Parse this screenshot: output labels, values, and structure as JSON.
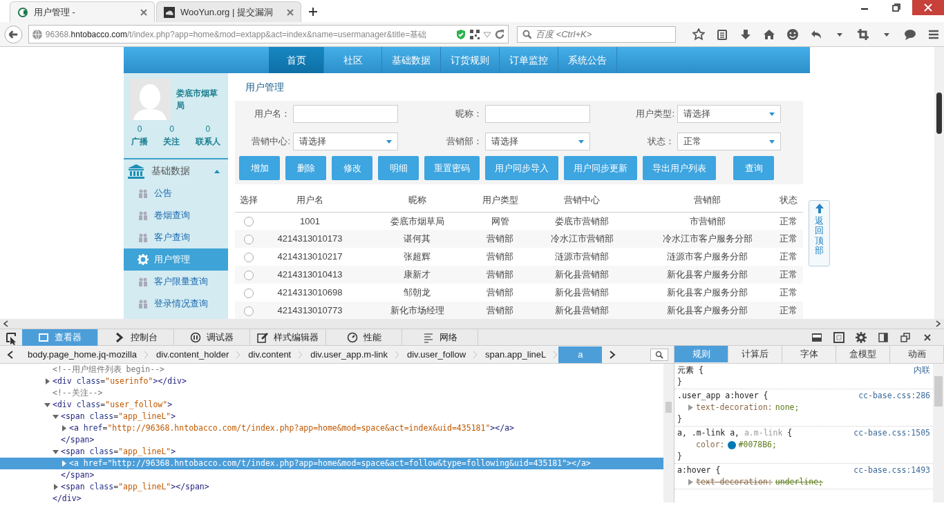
{
  "browser": {
    "tabs": [
      {
        "title": "用户管理 -",
        "selected": true
      },
      {
        "title": "WooYun.org | 提交漏洞",
        "selected": false
      }
    ],
    "url": {
      "subdomain": "96368.",
      "domain": "hntobacco.com",
      "path": "/t/index.php?app=home&mod=extapp&act=index&name=usermanager&title=基础"
    },
    "search": {
      "placeholder": "百度 <Ctrl+K>"
    }
  },
  "page": {
    "nav": [
      {
        "label": "首页",
        "selected": true
      },
      {
        "label": "社区",
        "selected": false
      },
      {
        "label": "基础数据",
        "selected": false
      },
      {
        "label": "订货规则",
        "selected": false
      },
      {
        "label": "订单监控",
        "selected": false
      },
      {
        "label": "系统公告",
        "selected": false
      }
    ],
    "profile": {
      "name": "娄底市烟草局",
      "stats": [
        {
          "count": "0",
          "label": "广播"
        },
        {
          "count": "0",
          "label": "关注"
        },
        {
          "count": "0",
          "label": "联系人"
        }
      ]
    },
    "sidebar": {
      "section": "基础数据",
      "expanded": true,
      "items": [
        {
          "label": "公告",
          "selected": false
        },
        {
          "label": "卷烟查询",
          "selected": false
        },
        {
          "label": "客户查询",
          "selected": false
        },
        {
          "label": "用户管理",
          "selected": true
        },
        {
          "label": "客户限量查询",
          "selected": false
        },
        {
          "label": "登录情况查询",
          "selected": false
        }
      ]
    },
    "title": "用户管理",
    "filters": [
      {
        "label": "用户名：",
        "kind": "text"
      },
      {
        "label": "昵称：",
        "kind": "text"
      },
      {
        "label": "用户类型:",
        "kind": "select",
        "value": "请选择"
      },
      {
        "label": "营销中心:",
        "kind": "select",
        "value": "请选择"
      },
      {
        "label": "营销部：",
        "kind": "select",
        "value": "请选择"
      },
      {
        "label": "状态：",
        "kind": "select",
        "value": "正常"
      }
    ],
    "buttons": [
      {
        "label": "增加",
        "kind": "action"
      },
      {
        "label": "删除",
        "kind": "action"
      },
      {
        "label": "修改",
        "kind": "action"
      },
      {
        "label": "明细",
        "kind": "action"
      },
      {
        "label": "重置密码",
        "kind": "action"
      },
      {
        "label": "用户同步导入",
        "kind": "action"
      },
      {
        "label": "用户同步更新",
        "kind": "action"
      },
      {
        "label": "导出用户列表",
        "kind": "action"
      },
      {
        "label": "查询",
        "kind": "search"
      }
    ],
    "table": {
      "select_column": "选择",
      "columns": [
        "用户名",
        "昵称",
        "用户类型",
        "营销中心",
        "营销部",
        "状态"
      ],
      "rows": [
        {
          "selected": false,
          "cells": [
            "1001",
            "娄底市烟草局",
            "网管",
            "娄底市营销部",
            "市营销部",
            "正常"
          ]
        },
        {
          "selected": false,
          "cells": [
            "4214313010173",
            "谌何其",
            "营销部",
            "冷水江市营销部",
            "冷水江市客户服务分部",
            "正常"
          ]
        },
        {
          "selected": false,
          "cells": [
            "4214313010217",
            "张超辉",
            "营销部",
            "涟源市营销部",
            "涟源市客户服务分部",
            "正常"
          ]
        },
        {
          "selected": false,
          "cells": [
            "4214313010413",
            "康新才",
            "营销部",
            "新化县营销部",
            "新化县客户服务分部",
            "正常"
          ]
        },
        {
          "selected": false,
          "cells": [
            "4214313010698",
            "邹朝龙",
            "营销部",
            "新化县营销部",
            "新化县客户服务分部",
            "正常"
          ]
        },
        {
          "selected": false,
          "cells": [
            "4214313010773",
            "新化市场经理",
            "营销部",
            "新化县营销部",
            "新化县客户服务分部",
            "正常"
          ]
        }
      ]
    },
    "back_to_top": "返回顶部"
  },
  "devtools": {
    "tabs": [
      {
        "label": "查看器",
        "selected": true
      },
      {
        "label": "控制台",
        "selected": false
      },
      {
        "label": "调试器",
        "selected": false
      },
      {
        "label": "样式编辑器",
        "selected": false
      },
      {
        "label": "性能",
        "selected": false
      },
      {
        "label": "网络",
        "selected": false
      }
    ],
    "breadcrumbs": [
      {
        "label": "body.page_home.jq-mozilla",
        "selected": false
      },
      {
        "label": "div.content_holder",
        "selected": false
      },
      {
        "label": "div.content",
        "selected": false
      },
      {
        "label": "div.user_app.m-link",
        "selected": false
      },
      {
        "label": "div.user_follow",
        "selected": false
      },
      {
        "label": "span.app_lineL",
        "selected": false
      },
      {
        "label": "a",
        "selected": true
      }
    ],
    "tree": [
      {
        "kind": "comment",
        "text": "<!--用户组件列表 begin-->"
      },
      {
        "kind": "element",
        "open": "<div class=\"userinfo\">",
        "close": "</div>",
        "expanded": false,
        "selected": false
      },
      {
        "kind": "comment",
        "text": "<!--关注-->"
      },
      {
        "kind": "element",
        "open": "<div class=\"user_follow\">",
        "close": "</div>",
        "expanded": true,
        "selected": false,
        "children": [
          {
            "kind": "element",
            "open": "<span class=\"app_lineL\">",
            "close": "</span>",
            "expanded": true,
            "selected": false,
            "children": [
              {
                "kind": "element",
                "open": "<a href=\"http://96368.hntobacco.com/t/index.php?app=home&mod=space&act=index&uid=435181\">",
                "close": "</a>",
                "expanded": false,
                "selected": false
              }
            ]
          },
          {
            "kind": "element",
            "open": "<span class=\"app_lineL\">",
            "close": "</span>",
            "expanded": true,
            "selected": false,
            "children": [
              {
                "kind": "element",
                "open": "<a href=\"http://96368.hntobacco.com/t/index.php?app=home&mod=space&act=follow&type=following&uid=435181\">",
                "close": "</a>",
                "expanded": false,
                "selected": true
              }
            ]
          },
          {
            "kind": "element",
            "open": "<span class=\"app_lineL\">",
            "close": "</span>",
            "expanded": false,
            "selected": false
          }
        ]
      }
    ],
    "side_tabs": [
      {
        "label": "规则",
        "selected": true
      },
      {
        "label": "计算后",
        "selected": false
      },
      {
        "label": "字体",
        "selected": false
      },
      {
        "label": "盒模型",
        "selected": false
      },
      {
        "label": "动画",
        "selected": false
      }
    ],
    "rules": [
      {
        "selector": [
          {
            "text": "元素 {",
            "matched": true
          }
        ],
        "source": "内联",
        "close": "}"
      },
      {
        "selector": [
          {
            "text": ".user_app a:hover {",
            "matched": true
          }
        ],
        "source": "cc-base.css:286",
        "declarations": [
          {
            "property": "text-decoration:",
            "value": "none;",
            "expandable": true,
            "overridden": false
          }
        ],
        "close": "}"
      },
      {
        "selector": [
          {
            "text": "a, .m-link a,",
            "matched": true
          },
          {
            "text": " a.m-link",
            "matched": false
          },
          {
            "text": " {",
            "matched": true
          }
        ],
        "source": "cc-base.css:1505",
        "declarations": [
          {
            "property": "color:",
            "value": "#0078B6;",
            "color": "#0078b6",
            "expandable": false,
            "overridden": false
          }
        ],
        "close": "}"
      },
      {
        "selector": [
          {
            "text": "a:hover {",
            "matched": true
          }
        ],
        "source": "cc-base.css:1493",
        "declarations": [
          {
            "property": "text-decoration:",
            "value": "underline;",
            "expandable": true,
            "overridden": true
          }
        ]
      }
    ]
  }
}
